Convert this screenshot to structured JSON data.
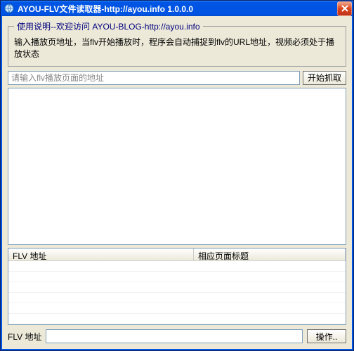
{
  "titlebar": {
    "title": "AYOU-FLV文件读取器-http://ayou.info 1.0.0.0",
    "close_label": "X"
  },
  "instructions": {
    "legend": "使用说明--欢迎访问 AYOU-BLOG-http://ayou.info",
    "text": "输入播放页地址，当flv开始播放时，程序会自动捕捉到flv的URL地址，视频必须处于播放状态"
  },
  "url_row": {
    "placeholder": "请输入flv播放页面的地址",
    "fetch_label": "开始抓取"
  },
  "listview": {
    "col1": "FLV 地址",
    "col2": "相应页面标题"
  },
  "bottom": {
    "label": "FLV 地址",
    "value": "",
    "action_label": "操作.."
  }
}
